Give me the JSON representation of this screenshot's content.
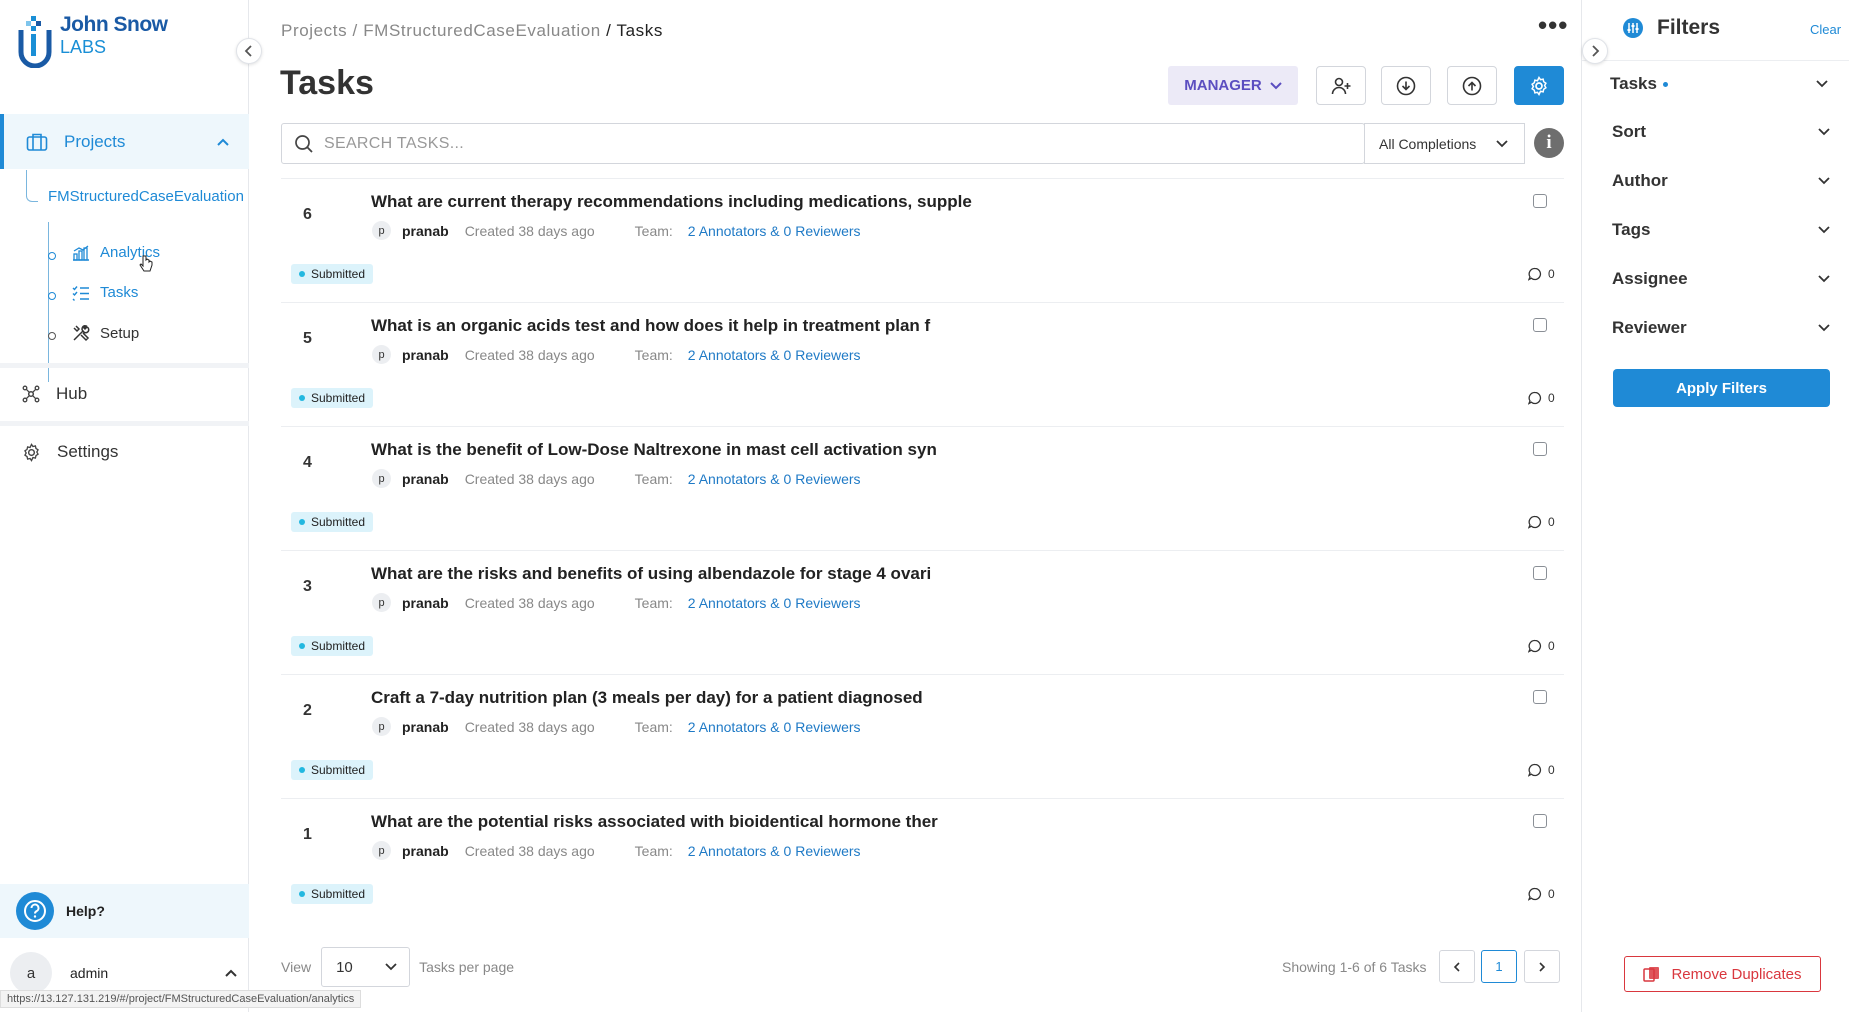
{
  "brand": {
    "line1": "John Snow",
    "line2": "LABS"
  },
  "sidebar": {
    "projects_label": "Projects",
    "project_name": "FMStructuredCaseEvaluation",
    "sub_items": [
      {
        "label": "Analytics",
        "icon": "chart-icon"
      },
      {
        "label": "Tasks",
        "icon": "list-icon"
      },
      {
        "label": "Setup",
        "icon": "tools-icon"
      }
    ],
    "hub_label": "Hub",
    "settings_label": "Settings",
    "help_label": "Help?",
    "user_initial": "a",
    "user_name": "admin"
  },
  "status_url": "https://13.127.131.219/#/project/FMStructuredCaseEvaluation/analytics",
  "header": {
    "breadcrumb_root": "Projects",
    "breadcrumb_project": "FMStructuredCaseEvaluation",
    "breadcrumb_current": "Tasks",
    "sep": " / ",
    "page_title": "Tasks",
    "role_label": "MANAGER"
  },
  "search": {
    "placeholder": "SEARCH TASKS...",
    "value": "",
    "completions_label": "All Completions",
    "info_icon": "i"
  },
  "tasks": [
    {
      "num": "6",
      "title": "What are current therapy recommendations including medications, supple",
      "author_initial": "p",
      "author": "pranab",
      "created": "Created 38 days ago",
      "team_label": "Team:",
      "team": "2 Annotators & 0 Reviewers",
      "status": "Submitted",
      "comments": "0"
    },
    {
      "num": "5",
      "title": "What is an organic acids test and how does it help in treatment plan f",
      "author_initial": "p",
      "author": "pranab",
      "created": "Created 38 days ago",
      "team_label": "Team:",
      "team": "2 Annotators & 0 Reviewers",
      "status": "Submitted",
      "comments": "0"
    },
    {
      "num": "4",
      "title": "What is the benefit of Low-Dose Naltrexone in mast cell activation syn",
      "author_initial": "p",
      "author": "pranab",
      "created": "Created 38 days ago",
      "team_label": "Team:",
      "team": "2 Annotators & 0 Reviewers",
      "status": "Submitted",
      "comments": "0"
    },
    {
      "num": "3",
      "title": "What are the risks and benefits of using albendazole for stage 4 ovari",
      "author_initial": "p",
      "author": "pranab",
      "created": "Created 38 days ago",
      "team_label": "Team:",
      "team": "2 Annotators & 0 Reviewers",
      "status": "Submitted",
      "comments": "0"
    },
    {
      "num": "2",
      "title": "Craft a 7-day nutrition plan (3 meals per day) for a patient diagnosed",
      "author_initial": "p",
      "author": "pranab",
      "created": "Created 38 days ago",
      "team_label": "Team:",
      "team": "2 Annotators & 0 Reviewers",
      "status": "Submitted",
      "comments": "0"
    },
    {
      "num": "1",
      "title": "What are the potential risks associated with bioidentical hormone ther",
      "author_initial": "p",
      "author": "pranab",
      "created": "Created 38 days ago",
      "team_label": "Team:",
      "team": "2 Annotators & 0 Reviewers",
      "status": "Submitted",
      "comments": "0"
    }
  ],
  "pagination": {
    "view_label": "View",
    "per_page_value": "10",
    "per_page_label": "Tasks per page",
    "showing": "Showing 1-6 of 6 Tasks",
    "current_page": "1"
  },
  "filters": {
    "title": "Filters",
    "clear_label": "Clear",
    "sections": [
      "Tasks",
      "Sort",
      "Author",
      "Tags",
      "Assignee",
      "Reviewer"
    ],
    "apply_label": "Apply Filters",
    "remove_duplicates_label": "Remove Duplicates"
  },
  "colors": {
    "accent": "#1f8ad6",
    "manager_text": "#5b4ec0",
    "danger": "#d9373e",
    "badge_bg": "#dcf3fb"
  }
}
